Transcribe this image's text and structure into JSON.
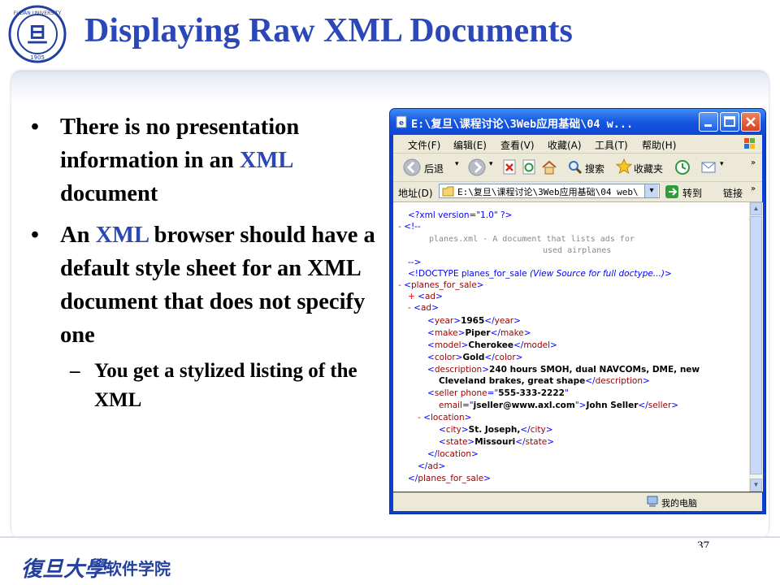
{
  "slide": {
    "title": "Displaying Raw XML Documents",
    "page_number": "37",
    "footer_logo_text": "復旦大學",
    "footer_dept": "软件学院",
    "accent_color": "#2b47b8"
  },
  "bullets": [
    {
      "parts": [
        "There is no presentation information in an ",
        "XML",
        " document"
      ]
    },
    {
      "parts": [
        "An ",
        "XML",
        " browser should have a default style sheet for an XML document that does not specify one"
      ]
    }
  ],
  "sub_bullet": "You get a stylized listing of the XML",
  "browser": {
    "title": "E:\\复旦\\课程讨论\\3Web应用基础\\04 w...",
    "menu": [
      "文件(F)",
      "编辑(E)",
      "查看(V)",
      "收藏(A)",
      "工具(T)",
      "帮助(H)"
    ],
    "toolbar": {
      "back": "后退",
      "search": "搜索",
      "favorites": "收藏夹"
    },
    "address_label": "地址(D)",
    "address_value": "E:\\复旦\\课程讨论\\3Web应用基础\\04 web\\",
    "go_label": "转到",
    "links_label": "链接",
    "status_text": "我的电脑",
    "xml": {
      "decl": "<?xml version=\"1.0\" ?>",
      "comment_open": "<!--",
      "comment_line1": "planes.xml - A document that lists ads for",
      "comment_line2": "used airplanes",
      "comment_close": "-->",
      "doctype": "<!DOCTYPE planes_for_sale ",
      "doctype_hint": "(View Source for full doctype...)",
      "doctype_end": ">",
      "root_tag": "planes_for_sale",
      "ad_tag": "ad",
      "year": "1965",
      "make": "Piper",
      "model": "Cherokee",
      "color": "Gold",
      "description_1": "240 hours SMOH, dual NAVCOMs, DME, new",
      "description_2": "Cleveland brakes, great shape",
      "seller_phone": "555-333-2222",
      "seller_email": "jseller@www.axl.com",
      "seller_name": "John Seller",
      "city": "St. Joseph,",
      "state": "Missouri"
    }
  }
}
